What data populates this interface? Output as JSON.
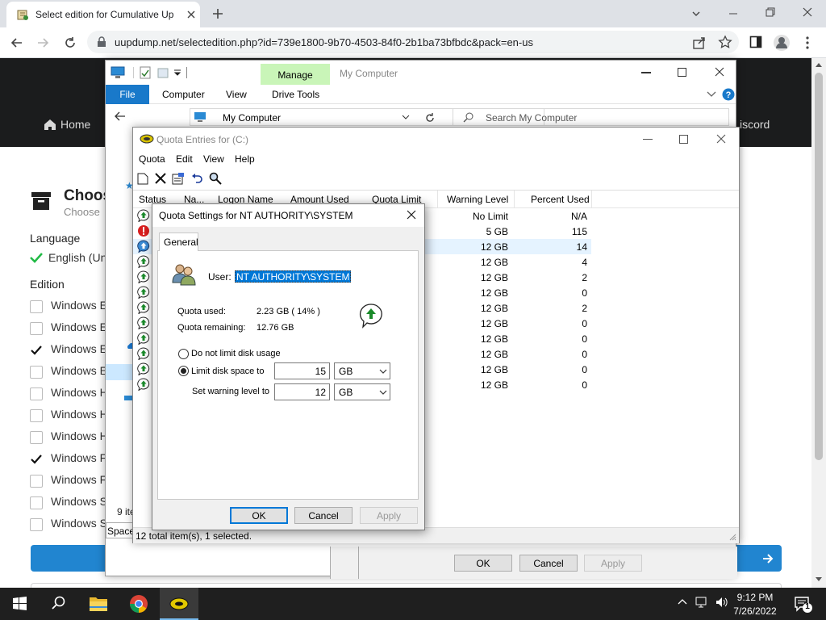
{
  "browser": {
    "tab_title": "Select edition for Cumulative Up",
    "url": "uupdump.net/selectedition.php?id=739e1800-9b70-4503-84f0-2b1ba73bfbdc&pack=en-us"
  },
  "site": {
    "nav_home": "Home",
    "nav_discord": "iscord",
    "heading": "Choos",
    "subheading": "Choose",
    "language_label": "Language",
    "language_value": "English (Un",
    "edition_label": "Edition",
    "editions": [
      {
        "label": "Windows E",
        "checked": false
      },
      {
        "label": "Windows E",
        "checked": false
      },
      {
        "label": "Windows E",
        "checked": true
      },
      {
        "label": "Windows E",
        "checked": false
      },
      {
        "label": "Windows H",
        "checked": false
      },
      {
        "label": "Windows H",
        "checked": false
      },
      {
        "label": "Windows H",
        "checked": false
      },
      {
        "label": "Windows F",
        "checked": true
      },
      {
        "label": "Windows F",
        "checked": false
      },
      {
        "label": "Windows S",
        "checked": false
      },
      {
        "label": "Windows S",
        "checked": false
      }
    ]
  },
  "explorer": {
    "title": "My Computer",
    "manage_tab": "Manage",
    "ribbon": {
      "file": "File",
      "computer": "Computer",
      "view": "View",
      "drive_tools": "Drive Tools"
    },
    "address": "My Computer",
    "search_placeholder": "Search My Computer",
    "item_count": "9 ite",
    "space_label": "Space",
    "ok": "OK",
    "cancel": "Cancel",
    "apply": "Apply"
  },
  "quota": {
    "title": "Quota Entries for  (C:)",
    "menu": [
      "Quota",
      "Edit",
      "View",
      "Help"
    ],
    "columns": [
      "Status",
      "Na...",
      "Logon Name",
      "Amount Used",
      "Quota Limit",
      "Warning Level",
      "Percent Used"
    ],
    "rows": [
      {
        "status": "ok",
        "warning": "No Limit",
        "percent": "N/A"
      },
      {
        "status": "over",
        "warning": "5 GB",
        "percent": "115"
      },
      {
        "status": "info",
        "warning": "12 GB",
        "percent": "14"
      },
      {
        "status": "ok",
        "warning": "12 GB",
        "percent": "4"
      },
      {
        "status": "ok",
        "warning": "12 GB",
        "percent": "2"
      },
      {
        "status": "ok",
        "warning": "12 GB",
        "percent": "0"
      },
      {
        "status": "ok",
        "warning": "12 GB",
        "percent": "2"
      },
      {
        "status": "ok",
        "warning": "12 GB",
        "percent": "0"
      },
      {
        "status": "ok",
        "warning": "12 GB",
        "percent": "0"
      },
      {
        "status": "ok",
        "warning": "12 GB",
        "percent": "0"
      },
      {
        "status": "ok",
        "warning": "12 GB",
        "percent": "0"
      },
      {
        "status": "ok",
        "warning": "12 GB",
        "percent": "0"
      }
    ],
    "status_text": "12 total item(s), 1 selected."
  },
  "dialog": {
    "title": "Quota Settings for NT AUTHORITY\\SYSTEM",
    "tab": "General",
    "user_label": "User:",
    "user_value": "NT AUTHORITY\\SYSTEM",
    "quota_used_label": "Quota used:",
    "quota_used_value": "2.23 GB  ( 14% )",
    "quota_remaining_label": "Quota remaining:",
    "quota_remaining_value": "12.76 GB",
    "radio_no_limit": "Do not limit disk usage",
    "radio_limit": "Limit disk space to",
    "limit_value": "15",
    "limit_unit": "GB",
    "warning_label": "Set warning level to",
    "warning_value": "12",
    "warning_unit": "GB",
    "ok": "OK",
    "cancel": "Cancel",
    "apply": "Apply"
  },
  "taskbar": {
    "time": "9:12 PM",
    "date": "7/26/2022",
    "notification_count": "1"
  }
}
